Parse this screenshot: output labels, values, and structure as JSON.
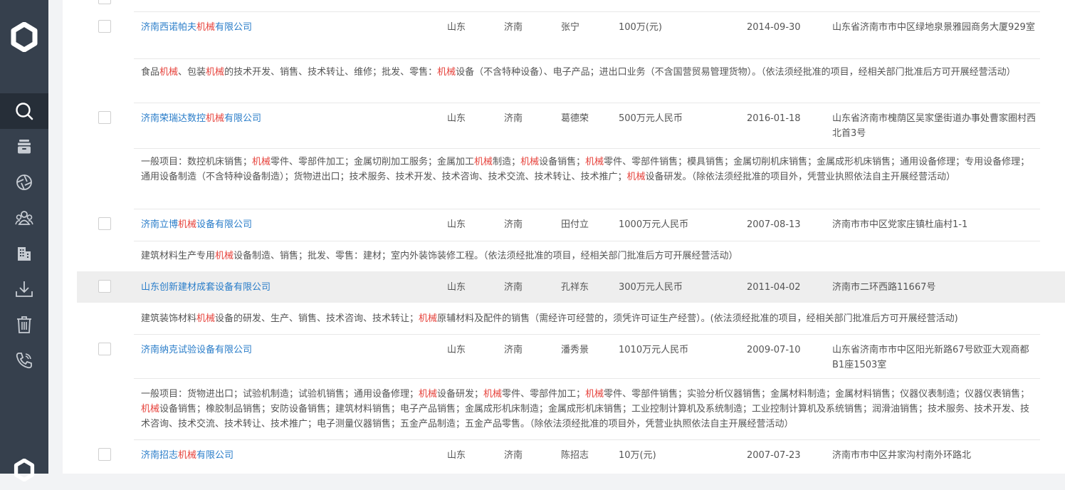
{
  "sidebar": {
    "items": [
      {
        "icon": "logo-icon"
      },
      {
        "icon": "search-icon",
        "active": true
      },
      {
        "icon": "layers-icon"
      },
      {
        "icon": "aperture-icon"
      },
      {
        "icon": "group-icon"
      },
      {
        "icon": "building-icon"
      },
      {
        "icon": "download-icon"
      },
      {
        "icon": "trash-icon"
      },
      {
        "icon": "phone-icon"
      },
      {
        "icon": "logo-icon"
      }
    ]
  },
  "keyword": "机械",
  "companies": [
    {
      "name_parts": [
        "济南西诺帕夫",
        "机械",
        "有限公司"
      ],
      "province": "山东",
      "city": "济南",
      "legal_person": "张宁",
      "capital": "100万(元)",
      "date": "2014-09-30",
      "address": "山东省济南市市中区绿地泉景雅园商务大厦929室",
      "scope_parts": [
        "食品",
        "机械",
        "、包装",
        "机械",
        "的技术开发、销售、技术转让、维修；批发、零售：",
        "机械",
        "设备（不含特种设备）、电子产品；进出口业务（不含国营贸易管理货物）。（依法须经批准的项目，经相关部门批准后方可开展经营活动）"
      ]
    },
    {
      "name_parts": [
        "济南荣瑞达数控",
        "机械",
        "有限公司"
      ],
      "province": "山东",
      "city": "济南",
      "legal_person": "葛德荣",
      "capital": "500万元人民币",
      "date": "2016-01-18",
      "address": "山东省济南市槐荫区吴家堡街道办事处曹家圈村西北首3号",
      "scope_parts": [
        "一般项目：数控机床销售；",
        "机械",
        "零件、零部件加工；金属切削加工服务；金属加工",
        "机械",
        "制造；",
        "机械",
        "设备销售；",
        "机械",
        "零件、零部件销售；模具销售；金属切削机床销售；金属成形机床销售；通用设备修理；专用设备修理；通用设备制造（不含特种设备制造）；货物进出口；技术服务、技术开发、技术咨询、技术交流、技术转让、技术推广；",
        "机械",
        "设备研发。（除依法须经批准的项目外，凭营业执照依法自主开展经营活动）"
      ]
    },
    {
      "name_parts": [
        "济南立博",
        "机械",
        "设备有限公司"
      ],
      "province": "山东",
      "city": "济南",
      "legal_person": "田付立",
      "capital": "1000万元人民币",
      "date": "2007-08-13",
      "address": "济南市市中区党家庄镇杜庙村1-1",
      "scope_parts": [
        "建筑材料生产专用",
        "机械",
        "设备制造、销售；批发、零售：建材；室内外装饰装修工程。（依法须经批准的项目，经相关部门批准后方可开展经营活动）"
      ]
    },
    {
      "name_parts": [
        "山东创新建材成套设备有限公司"
      ],
      "province": "山东",
      "city": "济南",
      "legal_person": "孔祥东",
      "capital": "300万元人民币",
      "date": "2011-04-02",
      "address": "济南市二环西路11667号",
      "highlighted": true,
      "scope_parts": [
        "建筑装饰材料",
        "机械",
        "设备的研发、生产、销售、技术咨询、技术转让；",
        "机械",
        "原辅材料及配件的销售（需经许可经营的，须凭许可证生产经营）。(依法须经批准的项目，经相关部门批准后方可开展经营活动)"
      ]
    },
    {
      "name_parts": [
        "济南纳克试验设备有限公司"
      ],
      "province": "山东",
      "city": "济南",
      "legal_person": "潘秀景",
      "capital": "1010万元人民币",
      "date": "2009-07-10",
      "address": "山东省济南市市中区阳光新路67号欧亚大观商都B1座1503室",
      "scope_parts": [
        "一般项目：货物进出口；试验机制造；试验机销售；通用设备修理；",
        "机械",
        "设备研发；",
        "机械",
        "零件、零部件加工；",
        "机械",
        "零件、零部件销售；实验分析仪器销售；金属材料制造；金属材料销售；仪器仪表制造；仪器仪表销售；",
        "机械",
        "设备销售；橡胶制品销售；安防设备销售；建筑材料销售；电子产品销售；金属成形机床制造；金属成形机床销售；工业控制计算机及系统制造；工业控制计算机及系统销售；润滑油销售；技术服务、技术开发、技术咨询、技术交流、技术转让、技术推广；电子测量仪器销售；五金产品制造；五金产品零售。（除依法须经批准的项目外，凭营业执照依法自主开展经营活动）"
      ]
    },
    {
      "name_parts": [
        "济南招志",
        "机械",
        "有限公司"
      ],
      "province": "山东",
      "city": "济南",
      "legal_person": "陈招志",
      "capital": "10万(元)",
      "date": "2007-07-23",
      "address": "济南市市中区井家沟村南外环路北",
      "scope_parts": []
    }
  ]
}
